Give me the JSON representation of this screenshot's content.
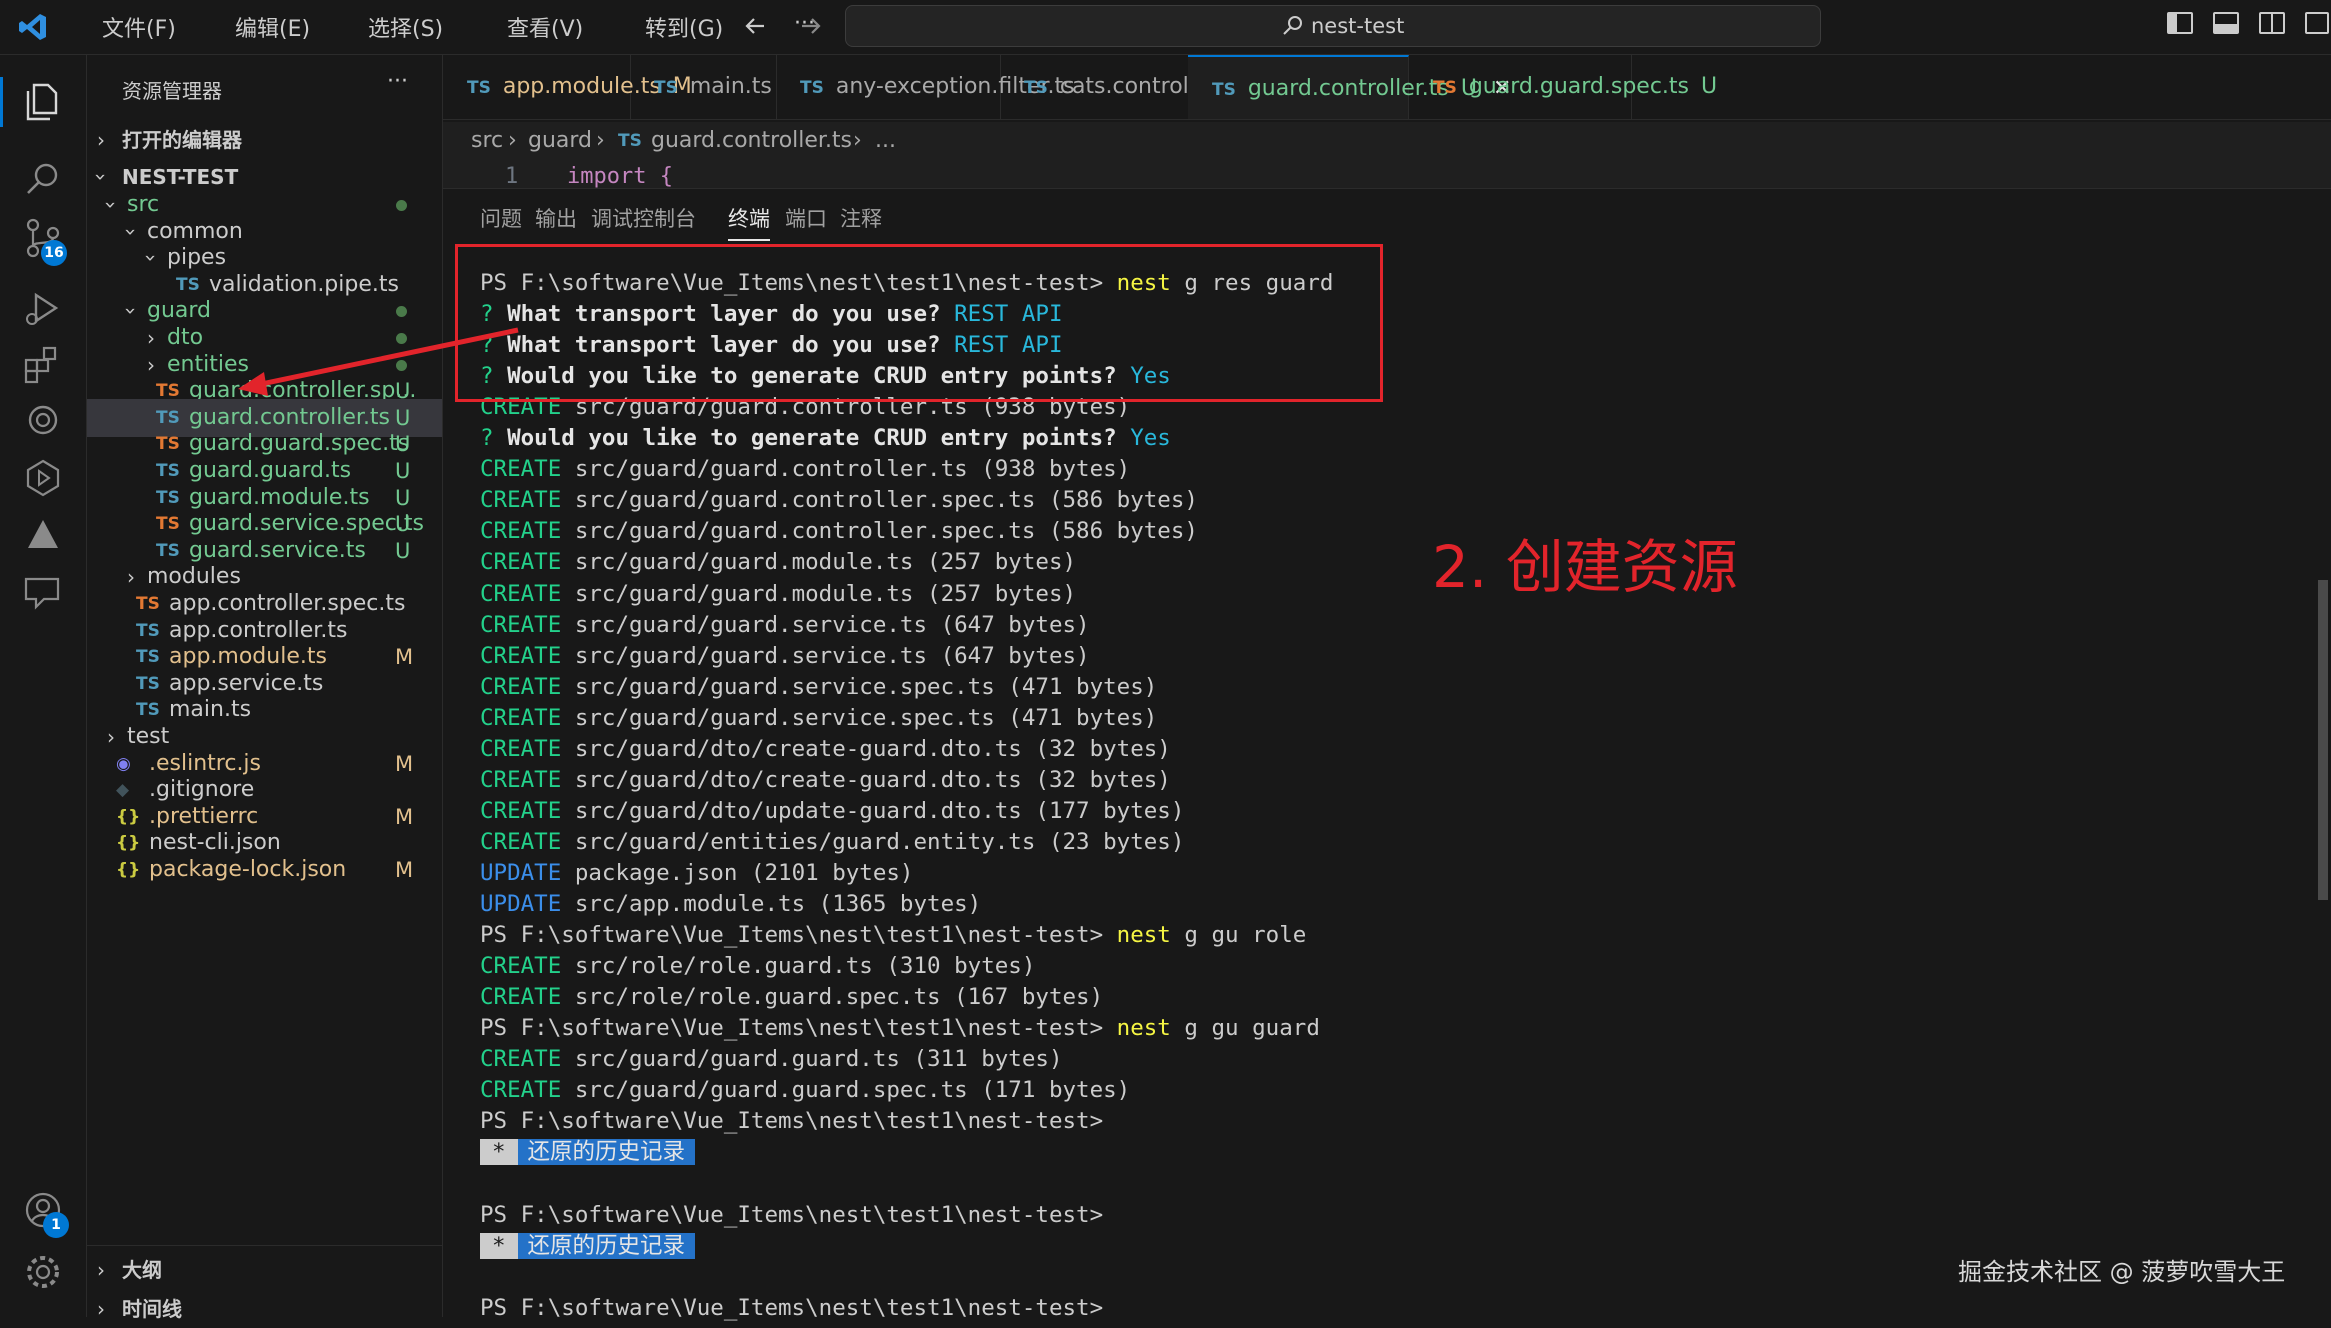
{
  "menu": [
    "文件(F)",
    "编辑(E)",
    "选择(S)",
    "查看(V)",
    "转到(G)",
    "···"
  ],
  "search": {
    "text": "nest-test"
  },
  "activity_bar": {
    "items": [
      "explorer-icon",
      "search-icon",
      "source-control-icon",
      "run-debug-icon",
      "extensions-icon",
      "chatgpt-icon",
      "test-icon",
      "deploy-icon",
      "comments-icon"
    ],
    "scm_badge": "16",
    "accounts_badge": "1"
  },
  "sidebar": {
    "title": "资源管理器",
    "more": "···",
    "open_editors": "打开的编辑器",
    "project": "NEST-TEST",
    "outline": "大纲",
    "timeline": "时间线",
    "tree": [
      {
        "label": "src",
        "type": "folder",
        "open": true,
        "depth": 1,
        "color": "#73c991",
        "dot": true
      },
      {
        "label": "common",
        "type": "folder",
        "open": true,
        "depth": 2,
        "color": "#cccccc"
      },
      {
        "label": "pipes",
        "type": "folder",
        "open": true,
        "depth": 3,
        "color": "#cccccc"
      },
      {
        "label": "validation.pipe.ts",
        "type": "ts",
        "icon": "blue",
        "depth": 4,
        "color": "#cccccc"
      },
      {
        "label": "guard",
        "type": "folder",
        "open": true,
        "depth": 2,
        "color": "#73c991",
        "dot": true
      },
      {
        "label": "dto",
        "type": "folder",
        "open": false,
        "depth": 3,
        "color": "#73c991",
        "dot": true
      },
      {
        "label": "entities",
        "type": "folder",
        "open": false,
        "depth": 3,
        "color": "#73c991",
        "dot": true
      },
      {
        "label": "guard.controller.sp...",
        "type": "ts",
        "icon": "orange",
        "depth": 3,
        "color": "#73c991",
        "status": "U"
      },
      {
        "label": "guard.controller.ts",
        "type": "ts",
        "icon": "blue",
        "depth": 3,
        "color": "#73c991",
        "status": "U",
        "selected": true
      },
      {
        "label": "guard.guard.spec.ts",
        "type": "ts",
        "icon": "orange",
        "depth": 3,
        "color": "#73c991",
        "status": "U"
      },
      {
        "label": "guard.guard.ts",
        "type": "ts",
        "icon": "blue",
        "depth": 3,
        "color": "#73c991",
        "status": "U"
      },
      {
        "label": "guard.module.ts",
        "type": "ts",
        "icon": "blue",
        "depth": 3,
        "color": "#73c991",
        "status": "U"
      },
      {
        "label": "guard.service.spec.ts",
        "type": "ts",
        "icon": "orange",
        "depth": 3,
        "color": "#73c991",
        "status": "U"
      },
      {
        "label": "guard.service.ts",
        "type": "ts",
        "icon": "blue",
        "depth": 3,
        "color": "#73c991",
        "status": "U"
      },
      {
        "label": "modules",
        "type": "folder",
        "open": false,
        "depth": 2,
        "color": "#cccccc"
      },
      {
        "label": "app.controller.spec.ts",
        "type": "ts",
        "icon": "orange",
        "depth": 2,
        "color": "#cccccc"
      },
      {
        "label": "app.controller.ts",
        "type": "ts",
        "icon": "blue",
        "depth": 2,
        "color": "#cccccc"
      },
      {
        "label": "app.module.ts",
        "type": "ts",
        "icon": "blue",
        "depth": 2,
        "color": "#e2c08d",
        "status": "M"
      },
      {
        "label": "app.service.ts",
        "type": "ts",
        "icon": "blue",
        "depth": 2,
        "color": "#cccccc"
      },
      {
        "label": "main.ts",
        "type": "ts",
        "icon": "blue",
        "depth": 2,
        "color": "#cccccc"
      },
      {
        "label": "test",
        "type": "folder",
        "open": false,
        "depth": 1,
        "color": "#cccccc"
      },
      {
        "label": ".eslintrc.js",
        "type": "eslint",
        "depth": 1,
        "color": "#e2c08d",
        "status": "M"
      },
      {
        "label": ".gitignore",
        "type": "git",
        "depth": 1,
        "color": "#cccccc"
      },
      {
        "label": ".prettierrc",
        "type": "json",
        "depth": 1,
        "color": "#e2c08d",
        "status": "M"
      },
      {
        "label": "nest-cli.json",
        "type": "json",
        "depth": 1,
        "color": "#cccccc"
      },
      {
        "label": "package-lock.json",
        "type": "json",
        "depth": 1,
        "color": "#e2c08d",
        "status": "M"
      }
    ]
  },
  "tabs": [
    {
      "label": "app.module.ts",
      "status": "M",
      "color": "#e2c08d",
      "icon": "TS"
    },
    {
      "label": "main.ts",
      "status": "",
      "color": "#a9a9a9",
      "icon": "TS"
    },
    {
      "label": "any-exception.filter.ts",
      "status": "",
      "color": "#a9a9a9",
      "icon": "TS"
    },
    {
      "label": "cats.controller.ts",
      "status": "",
      "color": "#a9a9a9",
      "icon": "TS"
    },
    {
      "label": "guard.controller.ts",
      "status": "U",
      "color": "#73c991",
      "icon": "TS",
      "active": true,
      "close": "✕"
    },
    {
      "label": "guard.guard.spec.ts",
      "status": "U",
      "color": "#73c991",
      "icon": "TS",
      "orange": true
    }
  ],
  "breadcrumb": {
    "parts": [
      "src",
      "guard",
      "guard.controller.ts",
      "..."
    ],
    "icon": "TS"
  },
  "code_peek": {
    "line_no": "1",
    "text": "import {"
  },
  "panel_tabs": [
    "问题",
    "输出",
    "调试控制台",
    "终端",
    "端口",
    "注释"
  ],
  "panel_active": 3,
  "terminal": [
    [
      {
        "t": "PS F:\\software\\Vue_Items\\nest\\test1\\nest-test> "
      },
      {
        "t": "nest",
        "c": "cmd"
      },
      {
        "t": " g res guard"
      }
    ],
    [
      {
        "t": "? ",
        "c": "kw-q"
      },
      {
        "t": "What transport layer do you use?",
        "c": "b"
      },
      {
        "t": " "
      },
      {
        "t": "REST API",
        "c": "ans"
      }
    ],
    [
      {
        "t": "? ",
        "c": "kw-q"
      },
      {
        "t": "What transport layer do you use?",
        "c": "b"
      },
      {
        "t": " "
      },
      {
        "t": "REST API",
        "c": "ans"
      }
    ],
    [
      {
        "t": "? ",
        "c": "kw-q"
      },
      {
        "t": "Would you like to generate CRUD entry points?",
        "c": "b"
      },
      {
        "t": " "
      },
      {
        "t": "Yes",
        "c": "ans"
      }
    ],
    [
      {
        "t": "CREATE",
        "c": "kw-create"
      },
      {
        "t": " src/guard/guard.controller.ts (938 bytes)"
      }
    ],
    [
      {
        "t": "? ",
        "c": "kw-q"
      },
      {
        "t": "Would you like to generate CRUD entry points?",
        "c": "b"
      },
      {
        "t": " "
      },
      {
        "t": "Yes",
        "c": "ans"
      }
    ],
    [
      {
        "t": "CREATE",
        "c": "kw-create"
      },
      {
        "t": " src/guard/guard.controller.ts (938 bytes)"
      }
    ],
    [
      {
        "t": "CREATE",
        "c": "kw-create"
      },
      {
        "t": " src/guard/guard.controller.spec.ts (586 bytes)"
      }
    ],
    [
      {
        "t": "CREATE",
        "c": "kw-create"
      },
      {
        "t": " src/guard/guard.controller.spec.ts (586 bytes)"
      }
    ],
    [
      {
        "t": "CREATE",
        "c": "kw-create"
      },
      {
        "t": " src/guard/guard.module.ts (257 bytes)"
      }
    ],
    [
      {
        "t": "CREATE",
        "c": "kw-create"
      },
      {
        "t": " src/guard/guard.module.ts (257 bytes)"
      }
    ],
    [
      {
        "t": "CREATE",
        "c": "kw-create"
      },
      {
        "t": " src/guard/guard.service.ts (647 bytes)"
      }
    ],
    [
      {
        "t": "CREATE",
        "c": "kw-create"
      },
      {
        "t": " src/guard/guard.service.ts (647 bytes)"
      }
    ],
    [
      {
        "t": "CREATE",
        "c": "kw-create"
      },
      {
        "t": " src/guard/guard.service.spec.ts (471 bytes)"
      }
    ],
    [
      {
        "t": "CREATE",
        "c": "kw-create"
      },
      {
        "t": " src/guard/guard.service.spec.ts (471 bytes)"
      }
    ],
    [
      {
        "t": "CREATE",
        "c": "kw-create"
      },
      {
        "t": " src/guard/dto/create-guard.dto.ts (32 bytes)"
      }
    ],
    [
      {
        "t": "CREATE",
        "c": "kw-create"
      },
      {
        "t": " src/guard/dto/create-guard.dto.ts (32 bytes)"
      }
    ],
    [
      {
        "t": "CREATE",
        "c": "kw-create"
      },
      {
        "t": " src/guard/dto/update-guard.dto.ts (177 bytes)"
      }
    ],
    [
      {
        "t": "CREATE",
        "c": "kw-create"
      },
      {
        "t": " src/guard/entities/guard.entity.ts (23 bytes)"
      }
    ],
    [
      {
        "t": "UPDATE",
        "c": "kw-update"
      },
      {
        "t": " package.json (2101 bytes)"
      }
    ],
    [
      {
        "t": "UPDATE",
        "c": "kw-update"
      },
      {
        "t": " src/app.module.ts (1365 bytes)"
      }
    ],
    [
      {
        "t": "PS F:\\software\\Vue_Items\\nest\\test1\\nest-test> "
      },
      {
        "t": "nest",
        "c": "cmd"
      },
      {
        "t": " g gu role"
      }
    ],
    [
      {
        "t": "CREATE",
        "c": "kw-create"
      },
      {
        "t": " src/role/role.guard.ts (310 bytes)"
      }
    ],
    [
      {
        "t": "CREATE",
        "c": "kw-create"
      },
      {
        "t": " src/role/role.guard.spec.ts (167 bytes)"
      }
    ],
    [
      {
        "t": "PS F:\\software\\Vue_Items\\nest\\test1\\nest-test> "
      },
      {
        "t": "nest",
        "c": "cmd"
      },
      {
        "t": " g gu guard"
      }
    ],
    [
      {
        "t": "CREATE",
        "c": "kw-create"
      },
      {
        "t": " src/guard/guard.guard.ts (311 bytes)"
      }
    ],
    [
      {
        "t": "CREATE",
        "c": "kw-create"
      },
      {
        "t": " src/guard/guard.guard.spec.ts (171 bytes)"
      }
    ],
    [
      {
        "t": "PS F:\\software\\Vue_Items\\nest\\test1\\nest-test>"
      }
    ],
    [
      {
        "t": "*",
        "c": "restore-star"
      },
      {
        "t": "还原的历史记录",
        "c": "restore"
      }
    ],
    [
      {
        "t": ""
      }
    ],
    [
      {
        "t": "PS F:\\software\\Vue_Items\\nest\\test1\\nest-test>"
      }
    ],
    [
      {
        "t": "*",
        "c": "restore-star"
      },
      {
        "t": "还原的历史记录",
        "c": "restore"
      }
    ],
    [
      {
        "t": ""
      }
    ],
    [
      {
        "t": "PS F:\\software\\Vue_Items\\nest\\test1\\nest-test>"
      }
    ]
  ],
  "annotation": "2. 创建资源",
  "watermark": "掘金技术社区 @ 菠萝吹雪大王"
}
